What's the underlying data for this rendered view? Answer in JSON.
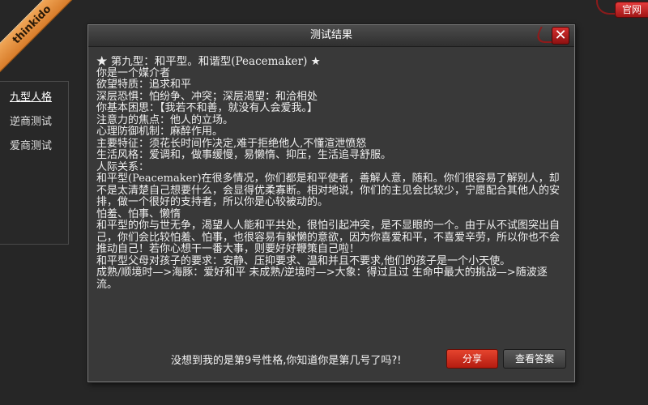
{
  "brand": {
    "ribbon_text": "thinkido",
    "official_label": "官网"
  },
  "sidebar": {
    "items": [
      {
        "label": "九型人格"
      },
      {
        "label": "逆商测试"
      },
      {
        "label": "爱商测试"
      }
    ]
  },
  "dialog": {
    "title": "测试结果",
    "close_label": "✕",
    "content_lines": [
      "★ 第九型：和平型。和谐型(Peacemaker) ★",
      "你是一个媒介者",
      "欲望特质：追求和平",
      "深层恐惧：怕纷争、冲突；深层渴望：和洽相处",
      "你基本困思：【我若不和善，就没有人会爱我。】",
      "注意力的焦点：他人的立场。",
      "心理防御机制：麻醉作用。",
      "主要特征：须花长时间作决定,难于拒绝他人,不懂渲泄愤怒",
      "生活风格：爱调和，做事缓慢，易懒惰、抑压，生活追寻舒服。",
      "人际关系：",
      "和平型(Peacemaker)在很多情况，你们都是和平使者，善解人意，随和。你们很容易了解别人，却不是太清楚自己想要什么，会显得优柔寡断。相对地说，你们的主见会比较少，宁愿配合其他人的安排，做一个很好的支持者，所以你是心较被动的。",
      "怕羞、怕事、懒惰",
      "和平型的你与世无争，渴望人人能和平共处，很怕引起冲突，是不显眼的一个。由于从不试图突出自己，你们会比较怕羞、怕事，也很容易有躲懒的意欲，因为你喜爱和平，不喜爱辛劳，所以你也不会推动自己！若你心想干一番大事，则要好好鞭策自己啦！",
      "和平型父母对孩子的要求：安静、压抑要求、温和并且不要求,他们的孩子是一个小天使。",
      "成熟/顺境时—>海豚：爱好和平 未成熟/逆境时—>大象：得过且过 生命中最大的挑战—>随波逐流。"
    ],
    "footer_text": "没想到我的是第9号性格,你知道你是第几号了吗?!",
    "share_label": "分享",
    "view_answer_label": "查看答案"
  }
}
